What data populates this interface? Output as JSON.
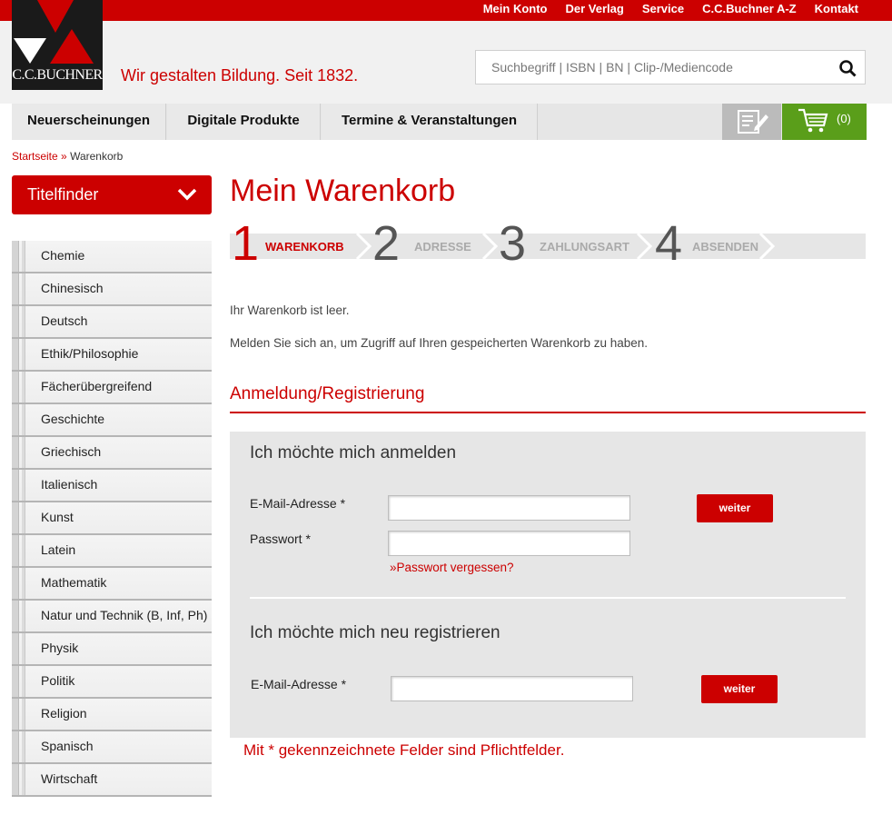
{
  "top_nav": [
    {
      "label": "Mein Konto"
    },
    {
      "label": "Der Verlag"
    },
    {
      "label": "Service"
    },
    {
      "label": "C.C.Buchner A-Z"
    },
    {
      "label": "Kontakt"
    }
  ],
  "logo": {
    "text": "C.C.BUCHNER"
  },
  "slogan": "Wir gestalten Bildung. Seit 1832.",
  "search": {
    "placeholder": "Suchbegriff | ISBN | BN | Clip-/Mediencode",
    "icon": "search-icon"
  },
  "main_nav": [
    {
      "label": "Neuerscheinungen"
    },
    {
      "label": "Digitale Produkte"
    },
    {
      "label": "Termine & Veranstaltungen"
    }
  ],
  "cart": {
    "count_label": "(0)"
  },
  "breadcrumb": {
    "home": "Startseite",
    "separator": "»",
    "current": "Warenkorb"
  },
  "titelfinder": {
    "label": "Titelfinder"
  },
  "subjects": [
    "Chemie",
    "Chinesisch",
    "Deutsch",
    "Ethik/Philosophie",
    "Fächerübergreifend",
    "Geschichte",
    "Griechisch",
    "Italienisch",
    "Kunst",
    "Latein",
    "Mathematik",
    "Natur und Technik (B, Inf, Ph)",
    "Physik",
    "Politik",
    "Religion",
    "Spanisch",
    "Wirtschaft"
  ],
  "page_title": "Mein Warenkorb",
  "steps": [
    {
      "num": "1",
      "label": "WARENKORB",
      "active": true
    },
    {
      "num": "2",
      "label": "ADRESSE",
      "active": false
    },
    {
      "num": "3",
      "label": "ZAHLUNGSART",
      "active": false
    },
    {
      "num": "4",
      "label": "ABSENDEN",
      "active": false
    }
  ],
  "messages": {
    "empty": "Ihr Warenkorb ist leer.",
    "login_hint": "Melden Sie sich an, um Zugriff auf Ihren gespeicherten Warenkorb zu haben."
  },
  "section_title": "Anmeldung/Registrierung",
  "login": {
    "heading": "Ich möchte mich anmelden",
    "email_label": "E-Mail-Adresse *",
    "password_label": "Passwort *",
    "email_value": "",
    "password_value": "",
    "submit": "weiter",
    "forgot": "»Passwort vergessen?"
  },
  "register": {
    "heading": "Ich möchte mich neu registrieren",
    "email_label": "E-Mail-Adresse *",
    "email_value": "",
    "submit": "weiter"
  },
  "required_note": "Mit * gekennzeichnete Felder sind Pflichtfelder.",
  "colors": {
    "brand_red": "#cc0000",
    "cart_green": "#5a9e1a",
    "panel_gray": "#e6e6e6"
  }
}
